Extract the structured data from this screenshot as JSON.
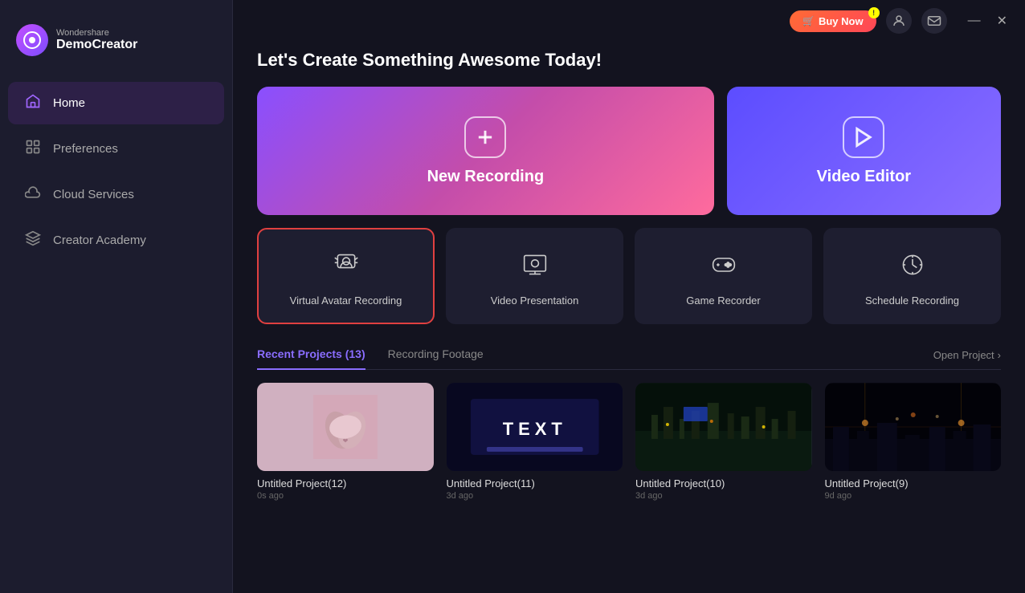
{
  "app": {
    "brand": "Wondershare",
    "name": "DemoCreator"
  },
  "titlebar": {
    "buy_now": "Buy Now",
    "profile_icon": "👤",
    "mail_icon": "✉",
    "minimize": "—",
    "close": "✕"
  },
  "sidebar": {
    "items": [
      {
        "id": "home",
        "label": "Home",
        "icon": "🏠",
        "active": true
      },
      {
        "id": "preferences",
        "label": "Preferences",
        "icon": "⊞"
      },
      {
        "id": "cloud",
        "label": "Cloud Services",
        "icon": "☁"
      },
      {
        "id": "academy",
        "label": "Creator Academy",
        "icon": "🎓"
      }
    ]
  },
  "main": {
    "title": "Let's Create Something Awesome Today!",
    "hero_cards": [
      {
        "id": "new-recording",
        "label": "New Recording",
        "icon": "+"
      },
      {
        "id": "video-editor",
        "label": "Video Editor",
        "icon": "▶"
      }
    ],
    "feature_cards": [
      {
        "id": "virtual-avatar",
        "label": "Virtual Avatar Recording",
        "icon": "👤",
        "selected": true
      },
      {
        "id": "video-presentation",
        "label": "Video Presentation",
        "icon": "📋"
      },
      {
        "id": "game-recorder",
        "label": "Game Recorder",
        "icon": "🎮"
      },
      {
        "id": "schedule-recording",
        "label": "Schedule Recording",
        "icon": "⏰"
      }
    ],
    "tabs": [
      {
        "id": "recent",
        "label": "Recent Projects (13)",
        "active": true
      },
      {
        "id": "footage",
        "label": "Recording Footage",
        "active": false
      }
    ],
    "open_project": "Open Project",
    "projects": [
      {
        "id": "p12",
        "name": "Untitled Project(12)",
        "time": "0s ago",
        "thumb": "hands"
      },
      {
        "id": "p11",
        "name": "Untitled Project(11)",
        "time": "3d ago",
        "thumb": "text"
      },
      {
        "id": "p10",
        "name": "Untitled Project(10)",
        "time": "3d ago",
        "thumb": "city"
      },
      {
        "id": "p9",
        "name": "Untitled Project(9)",
        "time": "9d ago",
        "thumb": "night"
      }
    ]
  }
}
